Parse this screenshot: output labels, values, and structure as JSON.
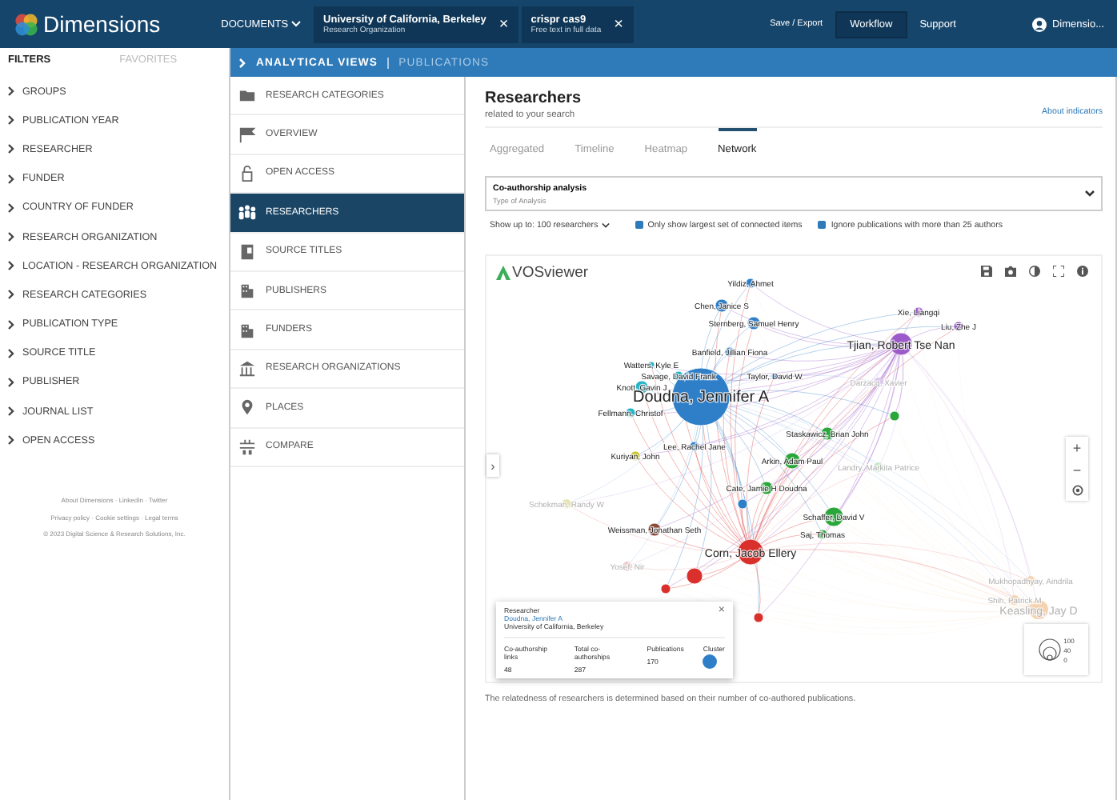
{
  "topbar": {
    "brand": "Dimensions",
    "documents": "DOCUMENTS",
    "chips": [
      {
        "title": "University of California, Berkeley",
        "subtitle": "Research Organization",
        "close": "×"
      },
      {
        "title": "crispr cas9",
        "subtitle": "Free text in full data",
        "close": "×"
      }
    ],
    "save_export": "Save / Export",
    "workflow": "Workflow",
    "support": "Support",
    "user": "Dimensio..."
  },
  "filters": {
    "tabs": [
      {
        "label": "FILTERS",
        "selected": true
      },
      {
        "label": "FAVORITES",
        "selected": false
      }
    ],
    "items": [
      "GROUPS",
      "PUBLICATION YEAR",
      "RESEARCHER",
      "FUNDER",
      "COUNTRY OF FUNDER",
      "RESEARCH ORGANIZATION",
      "LOCATION - RESEARCH ORGANIZATION",
      "RESEARCH CATEGORIES",
      "PUBLICATION TYPE",
      "SOURCE TITLE",
      "PUBLISHER",
      "JOURNAL LIST",
      "OPEN ACCESS"
    ],
    "footer": [
      "About Dimensions · LinkedIn · Twitter",
      "Privacy policy · Cookie settings · Legal terms"
    ],
    "copyright": "© 2023 Digital Science & Research Solutions, Inc."
  },
  "breadcrumb": {
    "current": "ANALYTICAL VIEWS",
    "next": "PUBLICATIONS"
  },
  "views": [
    {
      "label": "RESEARCH CATEGORIES",
      "selected": false
    },
    {
      "label": "OVERVIEW",
      "selected": false
    },
    {
      "label": "OPEN ACCESS",
      "selected": false
    },
    {
      "label": "RESEARCHERS",
      "selected": true
    },
    {
      "label": "SOURCE TITLES",
      "selected": false
    },
    {
      "label": "PUBLISHERS",
      "selected": false
    },
    {
      "label": "FUNDERS",
      "selected": false
    },
    {
      "label": "RESEARCH ORGANIZATIONS",
      "selected": false
    },
    {
      "label": "PLACES",
      "selected": false
    },
    {
      "label": "COMPARE",
      "selected": false
    }
  ],
  "main": {
    "title": "Researchers",
    "subtitle": "related to your search",
    "about": "About indicators",
    "tabs": [
      {
        "label": "Aggregated",
        "selected": false
      },
      {
        "label": "Timeline",
        "selected": false
      },
      {
        "label": "Heatmap",
        "selected": false
      },
      {
        "label": "Network",
        "selected": true
      }
    ],
    "analysis": {
      "value": "Co-authorship analysis",
      "label": "Type of Analysis"
    },
    "show_up_to": "Show up to: 100 researchers",
    "options": [
      {
        "label": "Only show largest set of connected items",
        "checked": true
      },
      {
        "label": "Ignore publications with more than 25 authors",
        "checked": true
      }
    ],
    "graph": {
      "logo": "VOSviewer",
      "expand": "›",
      "zoom_in": "+",
      "zoom_out": "−",
      "nodes": [
        {
          "label": "Yildiz, Ahmet",
          "color": "#2f7fc8",
          "kind": "node",
          "faded": false
        },
        {
          "label": "Chen, Janice S",
          "color": "#2f7fc8",
          "kind": "node",
          "faded": false
        },
        {
          "label": "Xie, Liangqi",
          "color": "#9b59c9",
          "kind": "node",
          "faded": false
        },
        {
          "label": "Sternberg, Samuel Henry",
          "color": "#2f7fc8",
          "kind": "node",
          "faded": false
        },
        {
          "label": "Liu, Zhe J",
          "color": "#9b59c9",
          "kind": "node",
          "faded": false
        },
        {
          "label": "Tjian, Robert Tse Nan",
          "color": "#9b59c9",
          "kind": "hub",
          "faded": false
        },
        {
          "label": "Banfield, Jillian Fiona",
          "color": "#2f7fc8",
          "kind": "node",
          "faded": false
        },
        {
          "label": "Watters, Kyle E",
          "color": "#22b5c9",
          "kind": "node",
          "faded": false
        },
        {
          "label": "Savage, David Frank",
          "color": "#22b5c9",
          "kind": "node",
          "faded": false
        },
        {
          "label": "Taylor, David W",
          "color": "#2f7fc8",
          "kind": "node",
          "faded": false
        },
        {
          "label": "Darzacq, Xavier",
          "color": "#d8c8ea",
          "kind": "node",
          "faded": true
        },
        {
          "label": "Knott, Gavin J",
          "color": "#22b5c9",
          "kind": "node",
          "faded": false
        },
        {
          "label": "Doudna, Jennifer A",
          "color": "#2f7fc8",
          "kind": "hub",
          "faded": false
        },
        {
          "label": "Fellmann, Christof",
          "color": "#22b5c9",
          "kind": "node",
          "faded": false
        },
        {
          "color": "#2aa63a",
          "kind": "node",
          "faded": false
        },
        {
          "label": "Staskawicz, Brian John",
          "color": "#2aa63a",
          "kind": "node",
          "faded": false
        },
        {
          "label": "Lee, Rachel Jane",
          "color": "#2f7fc8",
          "kind": "node",
          "faded": false
        },
        {
          "label": "Kuriyan, John",
          "color": "#c8c422",
          "kind": "node",
          "faded": false
        },
        {
          "label": "Arkin, Adam Paul",
          "color": "#2aa63a",
          "kind": "node",
          "faded": false
        },
        {
          "label": "Landry, Markita Patrice",
          "color": "#c6e6c6",
          "kind": "node",
          "faded": true
        },
        {
          "label": "Cate, Jamie H Doudna",
          "color": "#2aa63a",
          "kind": "node",
          "faded": false
        },
        {
          "label": "Schekman, Randy W",
          "color": "#e8e6b0",
          "kind": "node",
          "faded": true
        },
        {
          "color": "#2f7fc8",
          "kind": "node",
          "faded": false
        },
        {
          "label": "Schaffer, David V",
          "color": "#2aa63a",
          "kind": "node",
          "faded": false
        },
        {
          "label": "Weissman, Jonathan Seth",
          "color": "#8b4b3b",
          "kind": "node",
          "faded": false
        },
        {
          "label": "Saj, Thomas",
          "color": "#2aa63a",
          "kind": "node",
          "faded": false
        },
        {
          "label": "Corn, Jacob Ellery",
          "color": "#d9302c",
          "kind": "hub",
          "faded": false
        },
        {
          "label": "Yosef, Nir",
          "color": "#eecaca",
          "kind": "node",
          "faded": true
        },
        {
          "color": "#d9302c",
          "kind": "node",
          "faded": false
        },
        {
          "label": "Mukhopadhyay, Aindrila",
          "color": "#f5d2b0",
          "kind": "node",
          "faded": true
        },
        {
          "color": "#d9302c",
          "kind": "node",
          "faded": false
        },
        {
          "label": "Shih, Patrick M",
          "color": "#f5d2b0",
          "kind": "node",
          "faded": true
        },
        {
          "label": "Keasling, Jay D",
          "color": "#f5d2b0",
          "kind": "hub",
          "faded": true
        },
        {
          "color": "#d9302c",
          "kind": "node",
          "faded": false
        }
      ],
      "tooltip": {
        "heading": "Researcher",
        "name": "Doudna, Jennifer A",
        "org": "University of California, Berkeley",
        "close": "×",
        "stats": [
          {
            "label": "Co-authorship links",
            "value": "48"
          },
          {
            "label": "Total co-authorships",
            "value": "287"
          },
          {
            "label": "Publications",
            "value": "170"
          }
        ],
        "cluster": {
          "label": "Cluster",
          "color": "#2f7fc8"
        }
      },
      "legend": [
        "100",
        "40",
        "0"
      ]
    },
    "note": "The relatedness of researchers is determined based on their number of co-authored publications."
  }
}
